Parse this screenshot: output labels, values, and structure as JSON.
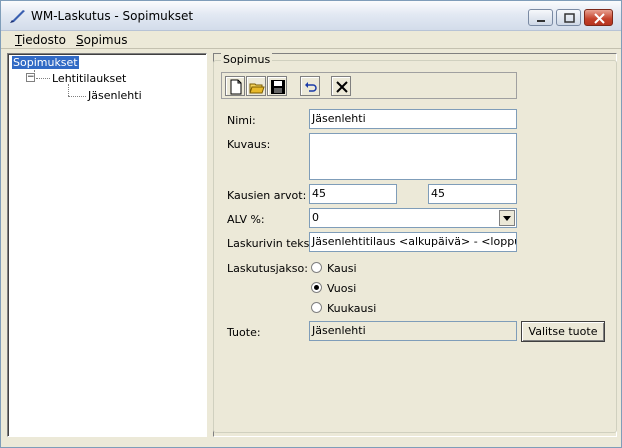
{
  "window": {
    "title": "WM-Laskutus - Sopimukset"
  },
  "menu": {
    "items": [
      {
        "label_rest": "iedosto",
        "accel": "T"
      },
      {
        "label_rest": "opimus",
        "accel": "S"
      }
    ]
  },
  "tree": {
    "root": "Sopimukset",
    "child": "Lehtitilaukset",
    "grandchild": "Jäsenlehti",
    "expander": "−"
  },
  "group": {
    "label": "Sopimus"
  },
  "toolbar": {
    "icons": [
      "new-document-icon",
      "open-folder-icon",
      "save-disk-icon",
      "undo-icon",
      "delete-x-icon"
    ]
  },
  "form": {
    "name_label": "Nimi:",
    "name_value": "Jäsenlehti",
    "desc_label": "Kuvaus:",
    "desc_value": "",
    "periods_label": "Kausien arvot:",
    "period_value_1": "45",
    "period_value_2": "45",
    "vat_label": "ALV %:",
    "vat_value": "0",
    "invoice_row_label": "Laskurivin teksti:",
    "invoice_row_value": "Jäsenlehtitilaus <alkupäivä> - <loppupäivä>",
    "billing_label": "Laskutusjakso:",
    "billing_options": [
      "Kausi",
      "Vuosi",
      "Kuukausi"
    ],
    "billing_selected": "Vuosi",
    "product_label": "Tuote:",
    "product_value": "Jäsenlehti",
    "select_product_button": "Valitse tuote"
  }
}
